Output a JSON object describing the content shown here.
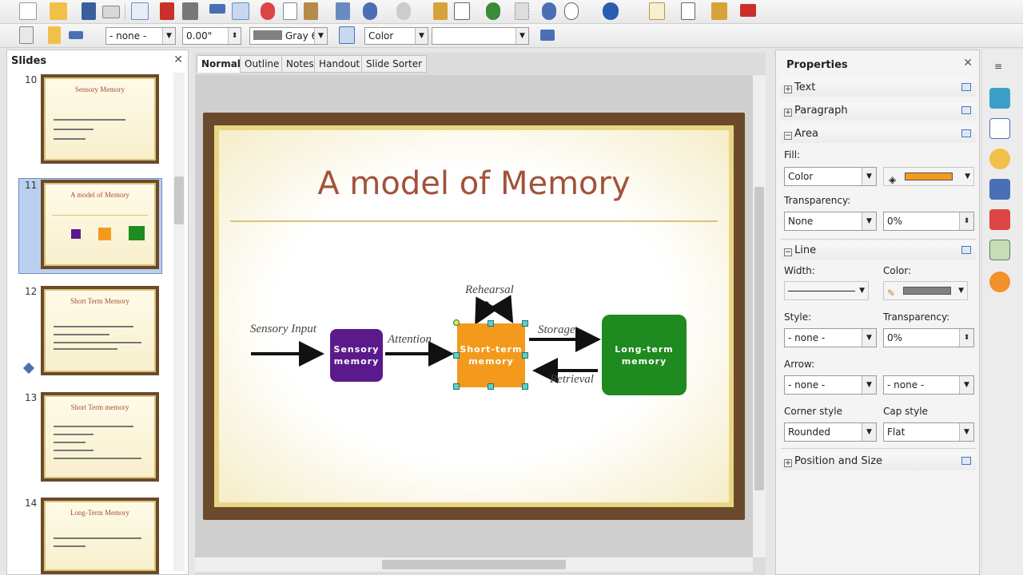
{
  "toolbar": {
    "line_style": "- none -",
    "line_width": "0.00\"",
    "line_color": "Gray 6",
    "area_style": "Color",
    "area_fill": ""
  },
  "slides_pane": {
    "title": "Slides",
    "slides": [
      {
        "number": "10",
        "title": "Sensory Memory"
      },
      {
        "number": "11",
        "title": "A model of Memory"
      },
      {
        "number": "12",
        "title": "Short Term Memory"
      },
      {
        "number": "13",
        "title": "Short Term memory"
      },
      {
        "number": "14",
        "title": "Long-Term Memory"
      }
    ]
  },
  "view_tabs": [
    "Normal",
    "Outline",
    "Notes",
    "Handout",
    "Slide Sorter"
  ],
  "slide": {
    "title": "A model of Memory",
    "labels": {
      "sensory_input": "Sensory Input",
      "attention": "Attention",
      "rehearsal": "Rehearsal",
      "storage": "Storage",
      "retrieval": "Retrieval"
    },
    "boxes": {
      "sensory": [
        "Sensory",
        "memory"
      ],
      "short_term": [
        "Short-term",
        "memory"
      ],
      "long_term": [
        "Long-term",
        "memory"
      ]
    }
  },
  "properties": {
    "title": "Properties",
    "sections": {
      "text": "Text",
      "paragraph": "Paragraph",
      "area": "Area",
      "line": "Line",
      "position": "Position and Size"
    },
    "area": {
      "fill_label": "Fill:",
      "fill_value": "Color",
      "fill_color": "#f39a1d",
      "transparency_label": "Transparency:",
      "transparency_value": "None",
      "transparency_pct": "0%"
    },
    "line": {
      "width_label": "Width:",
      "color_label": "Color:",
      "line_color": "#808080",
      "style_label": "Style:",
      "style_value": "- none -",
      "transparency_label": "Transparency:",
      "transparency_pct": "0%",
      "arrow_label": "Arrow:",
      "arrow_start": "- none -",
      "arrow_end": "- none -",
      "corner_label": "Corner style",
      "corner_value": "Rounded",
      "cap_label": "Cap style",
      "cap_value": "Flat"
    }
  },
  "colors": {
    "sensory": "#5b1a8c",
    "short_term": "#f39a1d",
    "long_term": "#1f8a1f",
    "title": "#a2523a"
  }
}
